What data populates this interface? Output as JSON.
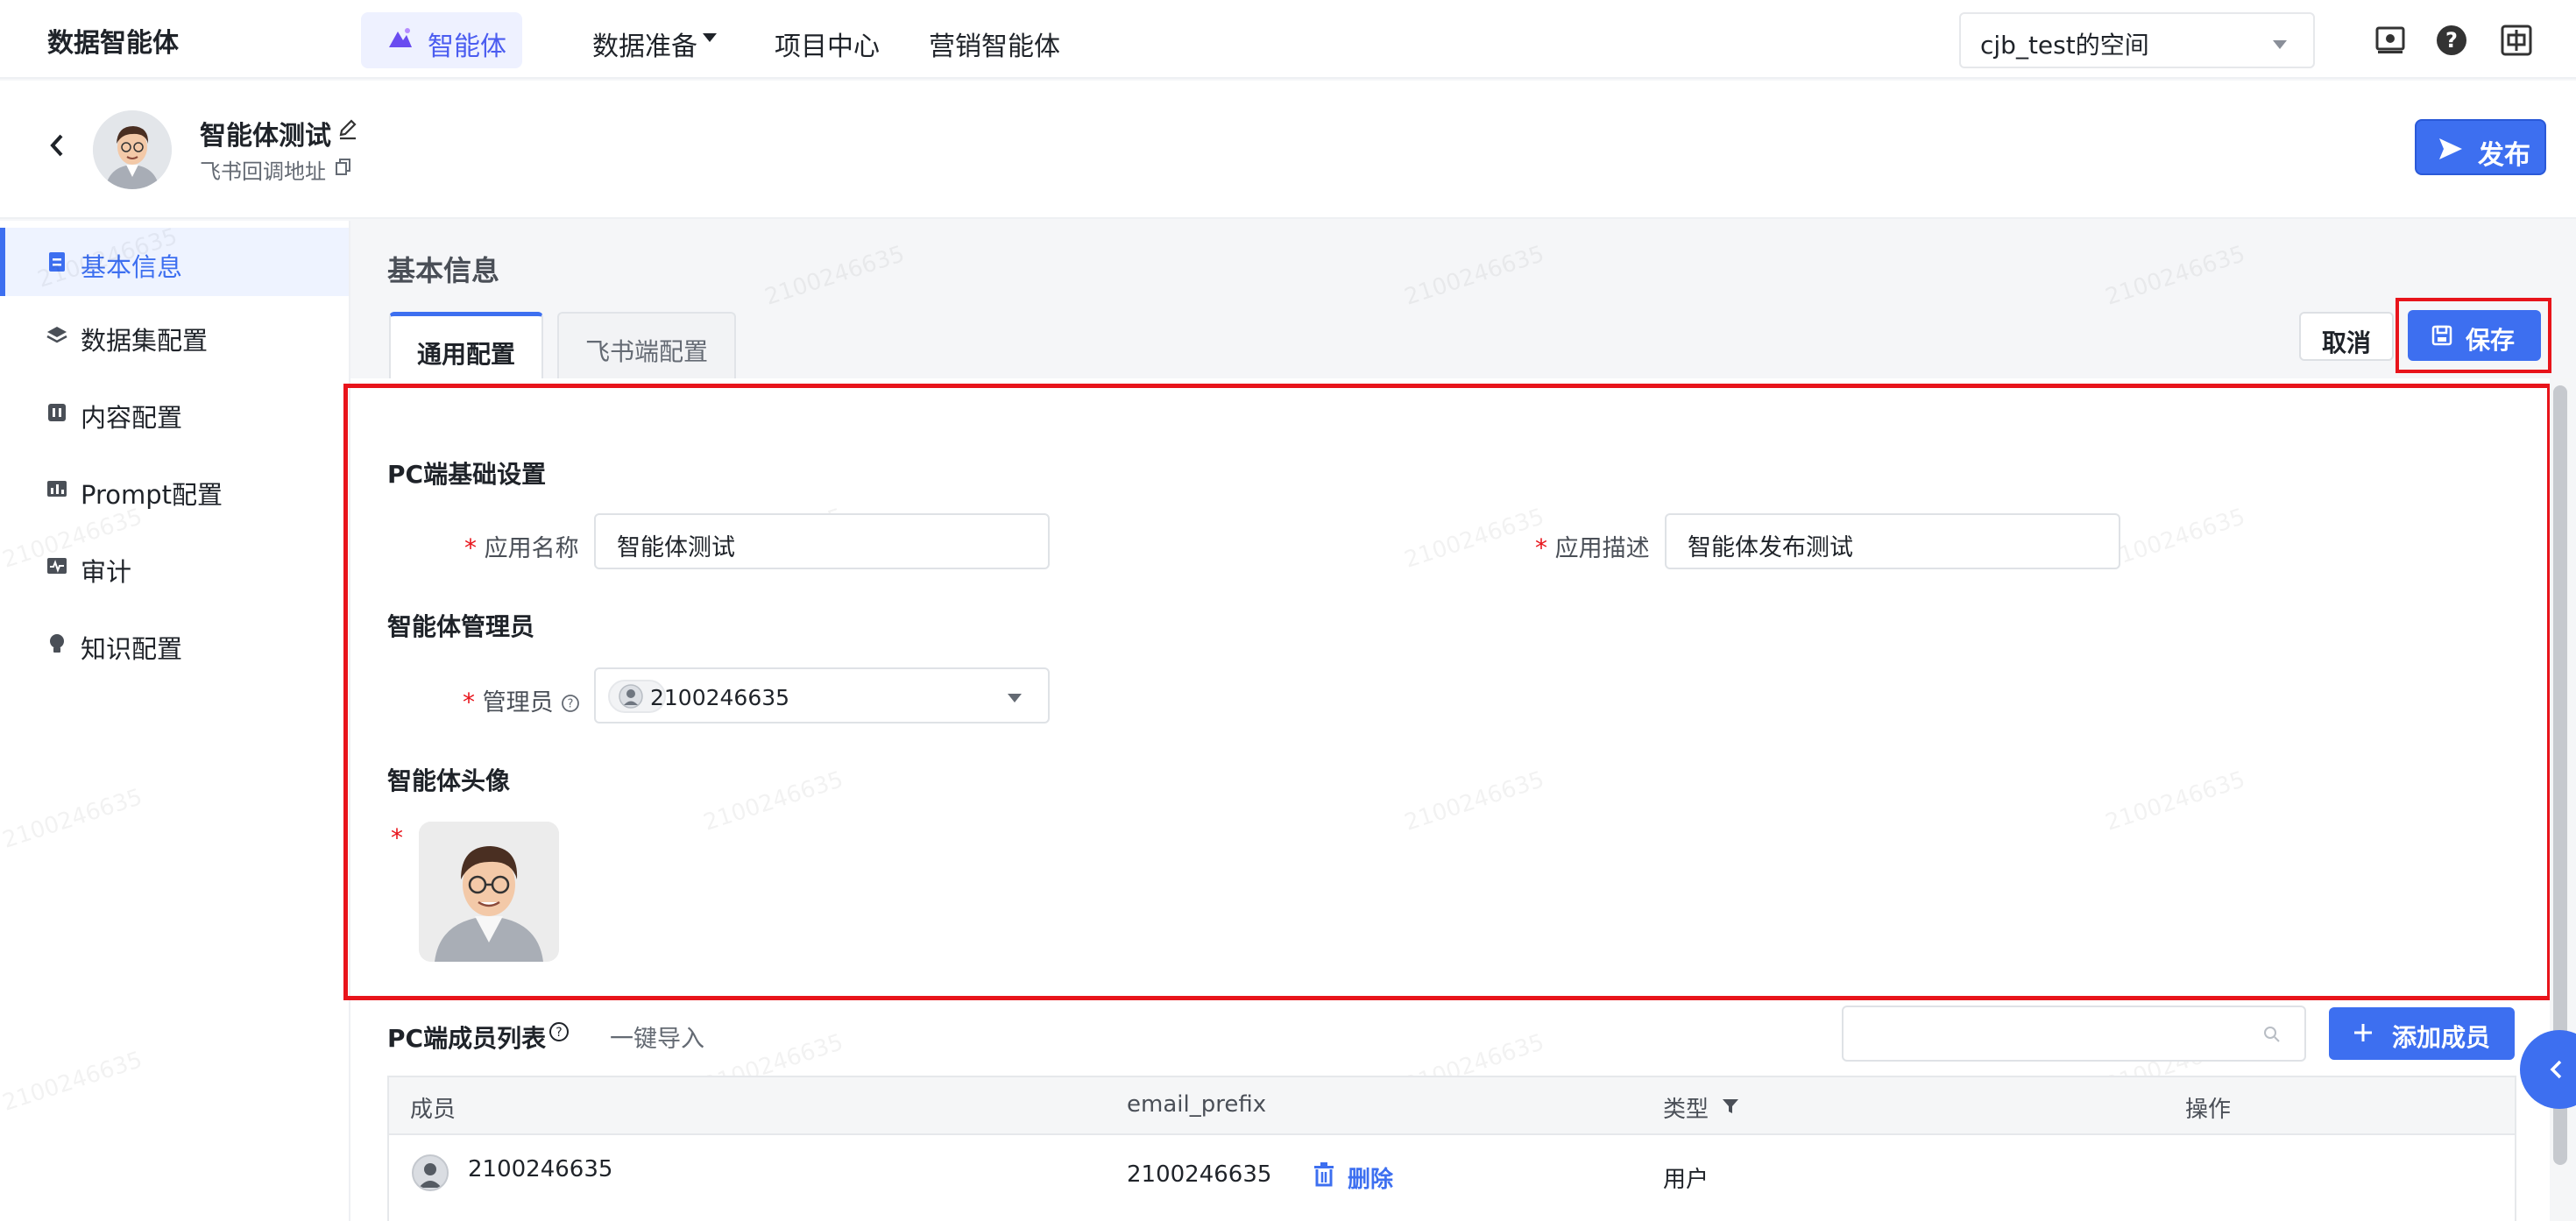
{
  "topnav": {
    "brand": "数据智能体",
    "items": [
      {
        "label": "智能体"
      },
      {
        "label": "数据准备"
      },
      {
        "label": "项目中心"
      },
      {
        "label": "营销智能体"
      }
    ],
    "space": "cjb_test的空间"
  },
  "header": {
    "agent_name": "智能体测试",
    "callback": "飞书回调地址",
    "publish_label": "发布"
  },
  "sidebar": {
    "items": [
      {
        "label": "基本信息"
      },
      {
        "label": "数据集配置"
      },
      {
        "label": "内容配置"
      },
      {
        "label": "Prompt配置"
      },
      {
        "label": "审计"
      },
      {
        "label": "知识配置"
      }
    ]
  },
  "main": {
    "title": "基本信息",
    "tabs": [
      {
        "label": "通用配置"
      },
      {
        "label": "飞书端配置"
      }
    ],
    "cancel_label": "取消",
    "save_label": "保存"
  },
  "form": {
    "pc_section": "PC端基础设置",
    "app_name_label": "应用名称",
    "app_name_value": "智能体测试",
    "app_desc_label": "应用描述",
    "app_desc_value": "智能体发布测试",
    "admin_section": "智能体管理员",
    "admin_label": "管理员",
    "admin_value": "2100246635",
    "avatar_section": "智能体头像",
    "required_mark": "*"
  },
  "members": {
    "title": "PC端成员列表",
    "import_label": "一键导入",
    "add_label": "添加成员",
    "columns": [
      "成员",
      "email_prefix",
      "类型",
      "操作"
    ],
    "rows": [
      {
        "member": "2100246635",
        "email_prefix": "2100246635",
        "type": "用户",
        "action": "删除"
      }
    ]
  },
  "watermark": "2100246635",
  "colors": {
    "accent": "#3d6ff0",
    "highlight": "#e8141b"
  }
}
